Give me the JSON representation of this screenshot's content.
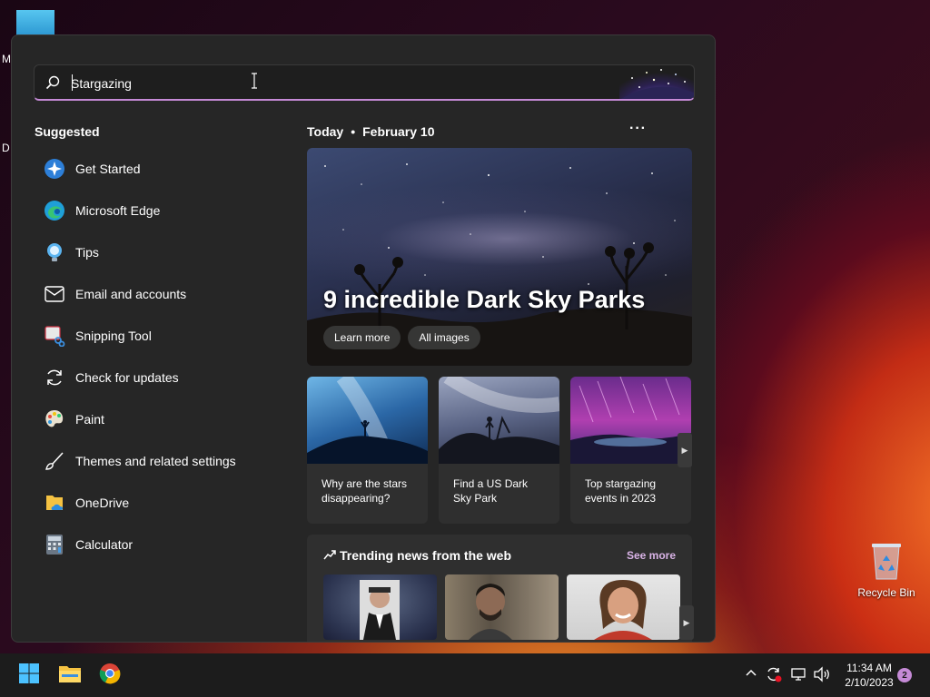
{
  "desktop": {
    "edge_text_1": "M",
    "edge_text_2": "D",
    "recycle_bin_label": "Recycle Bin"
  },
  "search": {
    "value": "Stargazing",
    "icon": "search-icon"
  },
  "suggested": {
    "title": "Suggested",
    "items": [
      {
        "label": "Get Started",
        "icon": "get-started-icon"
      },
      {
        "label": "Microsoft Edge",
        "icon": "edge-icon"
      },
      {
        "label": "Tips",
        "icon": "tips-icon"
      },
      {
        "label": "Email and accounts",
        "icon": "mail-icon"
      },
      {
        "label": "Snipping Tool",
        "icon": "snipping-tool-icon"
      },
      {
        "label": "Check for updates",
        "icon": "refresh-icon"
      },
      {
        "label": "Paint",
        "icon": "paint-icon"
      },
      {
        "label": "Themes and related settings",
        "icon": "brush-icon"
      },
      {
        "label": "OneDrive",
        "icon": "onedrive-icon"
      },
      {
        "label": "Calculator",
        "icon": "calculator-icon"
      }
    ]
  },
  "today": {
    "label": "Today",
    "separator": "•",
    "date": "February 10",
    "more": "···"
  },
  "hero": {
    "title": "9 incredible Dark Sky Parks",
    "buttons": [
      "Learn more",
      "All images"
    ]
  },
  "cards": [
    {
      "caption": "Why are the stars disappearing?"
    },
    {
      "caption": "Find a US Dark Sky Park"
    },
    {
      "caption": "Top stargazing events in 2023"
    }
  ],
  "trending": {
    "title": "Trending news from the web",
    "see_more": "See more"
  },
  "taskbar": {
    "time": "11:34 AM",
    "date": "2/10/2023",
    "notifications": "2"
  },
  "colors": {
    "accent": "#c58ad6",
    "panel_bg": "#262626",
    "taskbar_bg": "#1c1c1c"
  }
}
